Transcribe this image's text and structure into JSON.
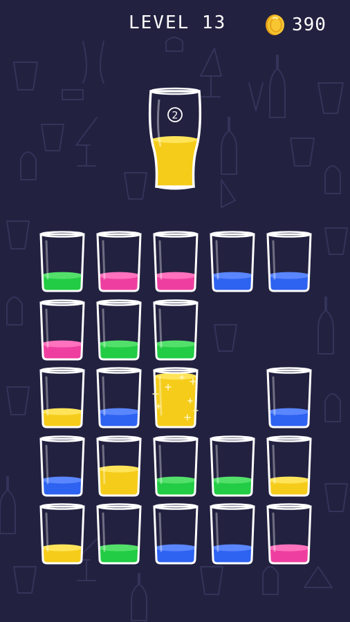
{
  "hud": {
    "level_label": "LEVEL 13",
    "coins": "390",
    "coin_icon": "coin-icon"
  },
  "target": {
    "count": "2",
    "color": "#f5cc1a"
  },
  "colors": {
    "green": "#22cc44",
    "pink": "#ee3fa0",
    "blue": "#2e62f0",
    "yellow": "#f5cc1a",
    "background": "#222140"
  },
  "grid": {
    "rows": [
      [
        {
          "color": "green",
          "level": 0.28
        },
        {
          "color": "pink",
          "level": 0.28
        },
        {
          "color": "pink",
          "level": 0.28
        },
        {
          "color": "blue",
          "level": 0.28
        },
        {
          "color": "blue",
          "level": 0.28
        }
      ],
      [
        {
          "color": "pink",
          "level": 0.28
        },
        {
          "color": "green",
          "level": 0.28
        },
        {
          "color": "green",
          "level": 0.28
        },
        null,
        null
      ],
      [
        {
          "color": "yellow",
          "level": 0.28
        },
        {
          "color": "blue",
          "level": 0.28
        },
        {
          "color": "yellow",
          "level": 0.92,
          "selected": true
        },
        null,
        {
          "color": "blue",
          "level": 0.28
        }
      ],
      [
        {
          "color": "blue",
          "level": 0.28
        },
        {
          "color": "yellow",
          "level": 0.48
        },
        {
          "color": "green",
          "level": 0.28
        },
        {
          "color": "green",
          "level": 0.28
        },
        {
          "color": "yellow",
          "level": 0.28
        }
      ],
      [
        {
          "color": "yellow",
          "level": 0.28
        },
        {
          "color": "green",
          "level": 0.28
        },
        {
          "color": "blue",
          "level": 0.28
        },
        {
          "color": "blue",
          "level": 0.28
        },
        {
          "color": "pink",
          "level": 0.28
        }
      ]
    ]
  }
}
